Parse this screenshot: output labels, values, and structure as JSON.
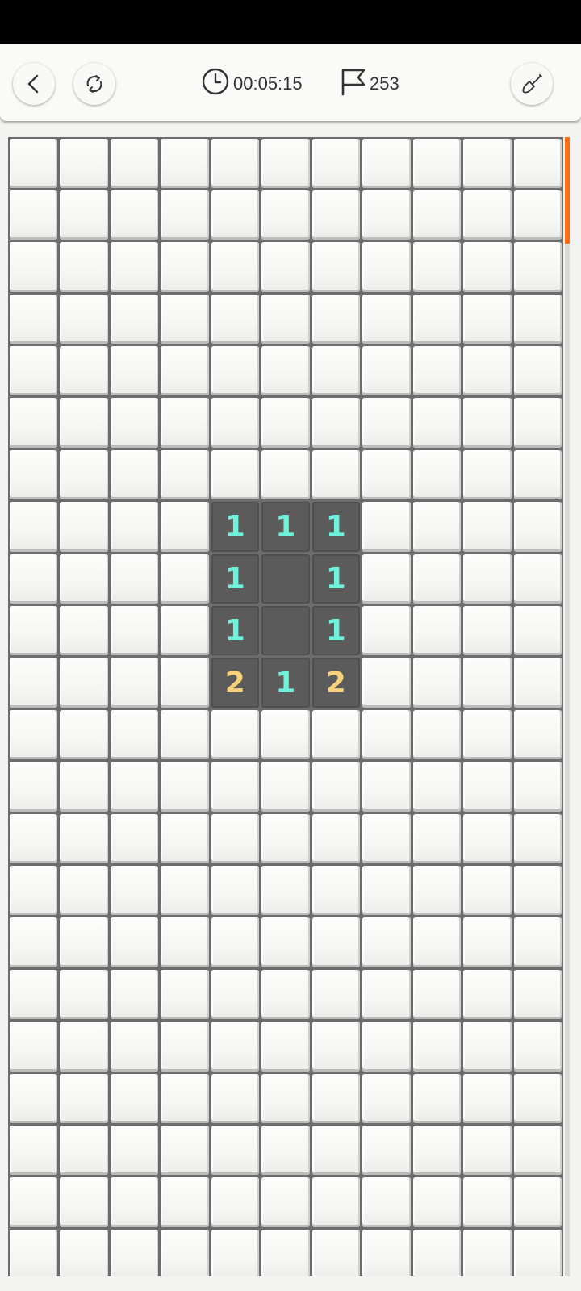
{
  "header": {
    "timer": "00:05:15",
    "flags": "253"
  },
  "icons": {
    "back": "chevron-left-icon",
    "restart": "refresh-icon",
    "clock": "clock-icon",
    "flag": "flag-icon",
    "shovel": "shovel-icon"
  },
  "colors": {
    "one": "#6ff2da",
    "two": "#f8d27a",
    "scroll_thumb": "#ff6d12"
  },
  "board": {
    "visible_columns": 11,
    "visible_rows": 23,
    "revealed": [
      {
        "row": 7,
        "col": 4,
        "value": "1"
      },
      {
        "row": 7,
        "col": 5,
        "value": "1"
      },
      {
        "row": 7,
        "col": 6,
        "value": "1"
      },
      {
        "row": 8,
        "col": 4,
        "value": "1"
      },
      {
        "row": 8,
        "col": 5,
        "value": ""
      },
      {
        "row": 8,
        "col": 6,
        "value": "1"
      },
      {
        "row": 9,
        "col": 4,
        "value": "1"
      },
      {
        "row": 9,
        "col": 5,
        "value": ""
      },
      {
        "row": 9,
        "col": 6,
        "value": "1"
      },
      {
        "row": 10,
        "col": 4,
        "value": "2"
      },
      {
        "row": 10,
        "col": 5,
        "value": "1"
      },
      {
        "row": 10,
        "col": 6,
        "value": "2"
      }
    ]
  }
}
